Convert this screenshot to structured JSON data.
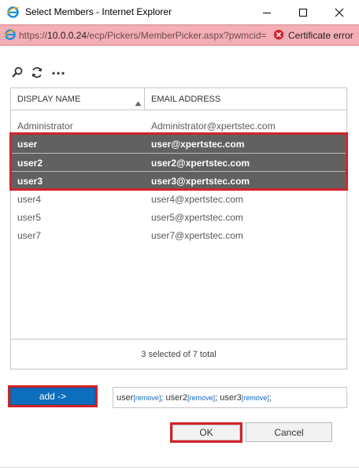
{
  "window": {
    "title": "Select Members - Internet Explorer",
    "controls": {
      "minimize": "minimize",
      "maximize": "maximize",
      "close": "close"
    }
  },
  "address_bar": {
    "url_scheme": "https://",
    "url_host": "10.0.0.24",
    "url_path": "/ecp/Pickers/MemberPicker.aspx?pwmcid=",
    "certificate_label": "Certificate error",
    "background_color": "#f4aeb5"
  },
  "toolbar": {
    "icons": [
      "search-icon",
      "refresh-icon",
      "more-icon"
    ],
    "more_glyph": "•••"
  },
  "list": {
    "columns": [
      "DISPLAY NAME",
      "EMAIL ADDRESS"
    ],
    "sort_indicator": "ascending",
    "rows": [
      {
        "name": "Administrator",
        "email": "Administrator@xpertstec.com",
        "selected": false
      },
      {
        "name": "user",
        "email": "user@xpertstec.com",
        "selected": true
      },
      {
        "name": "user2",
        "email": "user2@xpertstec.com",
        "selected": true
      },
      {
        "name": "user3",
        "email": "user3@xpertstec.com",
        "selected": true
      },
      {
        "name": "user4",
        "email": "user4@xpertstec.com",
        "selected": false
      },
      {
        "name": "user5",
        "email": "user5@xpertstec.com",
        "selected": false
      },
      {
        "name": "user7",
        "email": "user7@xpertstec.com",
        "selected": false
      }
    ],
    "status": "3 selected of 7 total",
    "selected_row_color": "#616161"
  },
  "add_button": {
    "label": "add ->",
    "color": "#0d6ebd"
  },
  "selection": {
    "items": [
      {
        "name": "user",
        "remove": "[remove]",
        "sep": ";"
      },
      {
        "name": "user2",
        "remove": "[remove]",
        "sep": ";"
      },
      {
        "name": "user3",
        "remove": "[remove]",
        "sep": ";"
      }
    ]
  },
  "dialog_buttons": {
    "ok": "OK",
    "cancel": "Cancel"
  },
  "highlight_color": "#d2232a"
}
